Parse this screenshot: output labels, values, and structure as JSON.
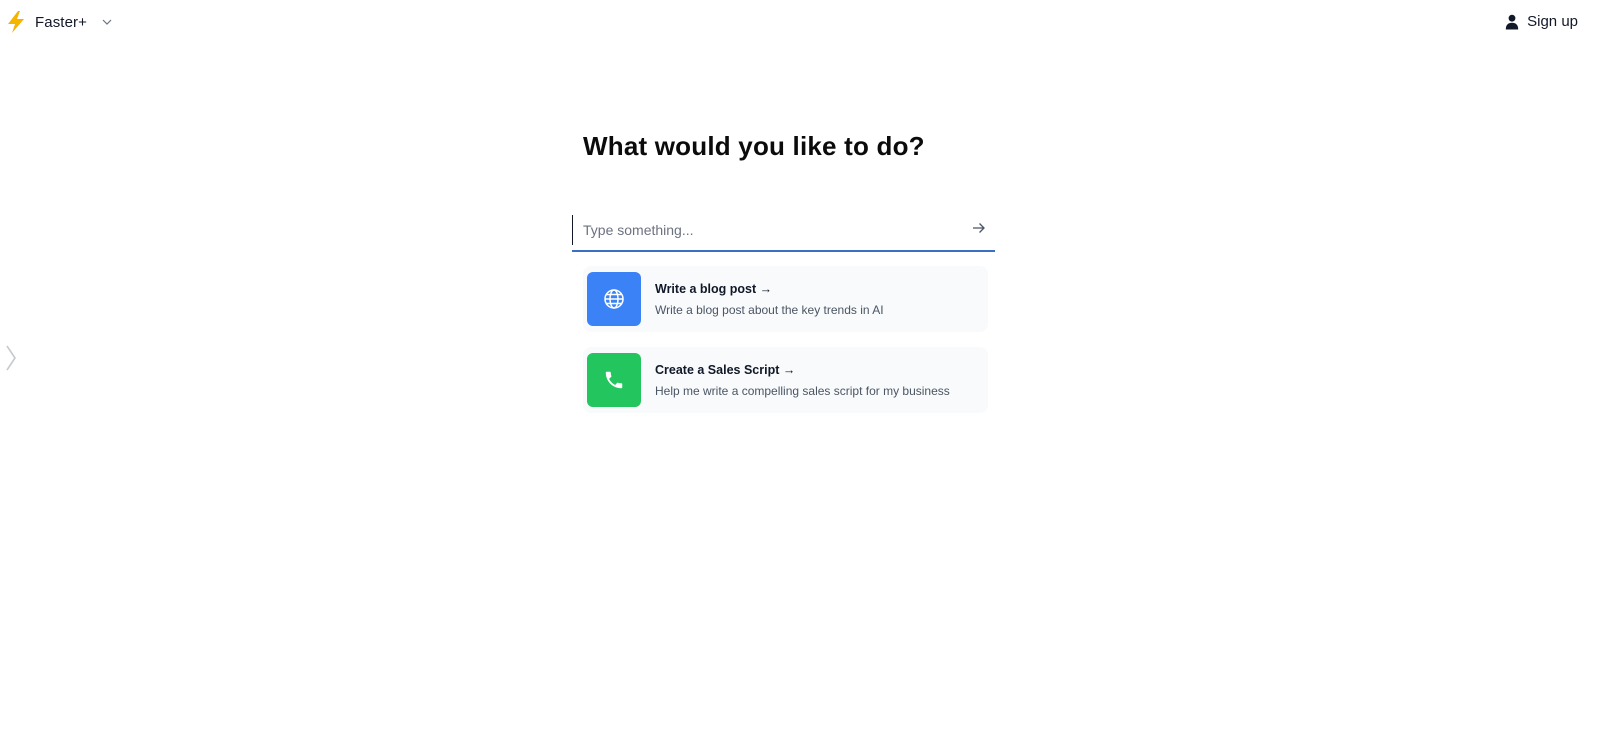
{
  "header": {
    "brand_name": "Faster+",
    "brand_icon": "lightning-bolt-icon",
    "brand_color": "#f5b400",
    "signup_label": "Sign up"
  },
  "main": {
    "heading": "What would you like to do?",
    "search": {
      "placeholder": "Type something...",
      "value": ""
    },
    "suggestions": [
      {
        "title": "Write a blog post →",
        "description": "Write a blog post about the key trends in AI",
        "icon": "globe-icon",
        "icon_bg": "#3b82f6"
      },
      {
        "title": "Create a Sales Script →",
        "description": "Help me write a compelling sales script for my business",
        "icon": "phone-icon",
        "icon_bg": "#22c55e"
      }
    ]
  }
}
